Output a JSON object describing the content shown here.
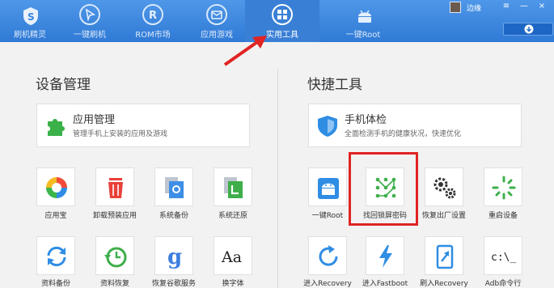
{
  "nav": {
    "tabs": [
      {
        "label": "刷机精灵",
        "icon": "shield-s-icon"
      },
      {
        "label": "一键刷机",
        "icon": "cursor-icon"
      },
      {
        "label": "ROM市场",
        "icon": "rom-r-icon"
      },
      {
        "label": "应用游戏",
        "icon": "envelope-icon"
      },
      {
        "label": "实用工具",
        "icon": "grid-icon",
        "active": true
      },
      {
        "label": "一键Root",
        "icon": "android-icon"
      }
    ],
    "username": "边缘",
    "window_controls": [
      "≡",
      "—",
      "×"
    ],
    "download_icon": "download-icon"
  },
  "left": {
    "title": "设备管理",
    "card": {
      "title": "应用管理",
      "subtitle": "管理手机上安装的应用及游戏",
      "icon": "puzzle-icon"
    },
    "tools_row1": [
      {
        "label": "应用宝",
        "icon": "yingyongbao-icon"
      },
      {
        "label": "卸载预装应用",
        "icon": "trash-icon"
      },
      {
        "label": "系统备份",
        "icon": "system-backup-icon"
      },
      {
        "label": "系统还原",
        "icon": "system-restore-icon"
      }
    ],
    "tools_row2": [
      {
        "label": "资料备份",
        "icon": "sync-icon"
      },
      {
        "label": "资料恢复",
        "icon": "history-icon"
      },
      {
        "label": "恢复谷歌服务",
        "icon": "google-icon"
      },
      {
        "label": "换字体",
        "icon": "font-icon"
      }
    ]
  },
  "right": {
    "title": "快捷工具",
    "card": {
      "title": "手机体检",
      "subtitle": "全面检测手机的健康状况，快速优化",
      "icon": "shield-check-icon"
    },
    "tools_row1": [
      {
        "label": "一键Root",
        "icon": "android-root-icon"
      },
      {
        "label": "找回锁屏密码",
        "icon": "pattern-lock-icon"
      },
      {
        "label": "恢复出厂设置",
        "icon": "gears-icon"
      },
      {
        "label": "重启设备",
        "icon": "restart-icon"
      }
    ],
    "tools_row2": [
      {
        "label": "进入Recovery",
        "icon": "refresh-icon"
      },
      {
        "label": "进入Fastboot",
        "icon": "lightning-icon"
      },
      {
        "label": "刷入Recovery",
        "icon": "flash-icon"
      },
      {
        "label": "Adb命令行",
        "icon": "terminal-icon"
      }
    ]
  },
  "font_tile_text": "Aa",
  "google_tile_text": "g",
  "terminal_tile_text": "c:\\_",
  "colors": {
    "nav_bg": "#3a85dd",
    "accent": "#2e7bd6",
    "highlight": "#e02424",
    "arrow": "#e02424"
  }
}
